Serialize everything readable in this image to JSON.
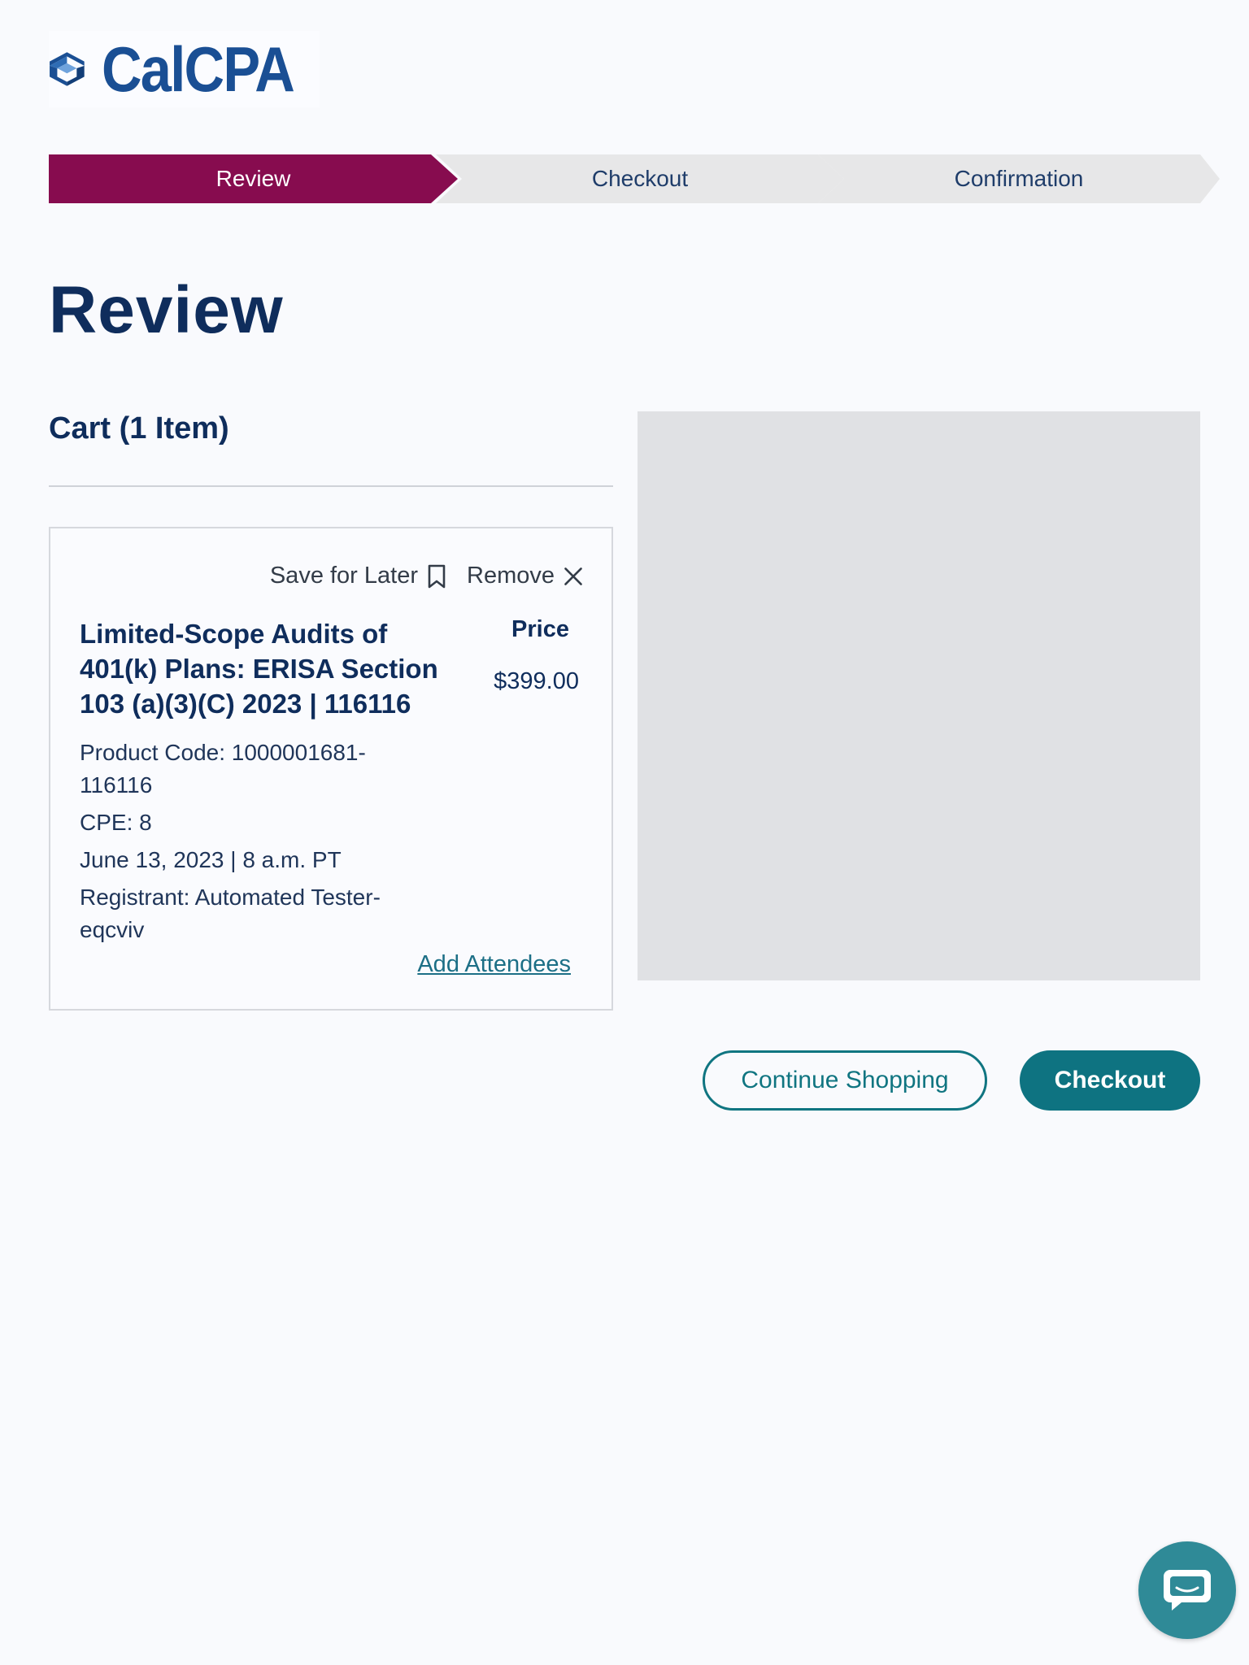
{
  "brand": {
    "name": "CalCPA",
    "icon": "calcpa-cube-logo-icon",
    "color": "#1a4f94"
  },
  "steps": [
    {
      "label": "Review",
      "active": true
    },
    {
      "label": "Checkout",
      "active": false
    },
    {
      "label": "Confirmation",
      "active": false
    }
  ],
  "page_title": "Review",
  "cart": {
    "heading": "Cart (1 Item)",
    "item": {
      "save_label": "Save for Later",
      "save_icon": "bookmark-icon",
      "remove_label": "Remove",
      "remove_icon": "close-icon",
      "title": "Limited-Scope Audits of 401(k) Plans: ERISA Section 103 (a)(3)(C) 2023 | 116116",
      "price_label": "Price",
      "price": "$399.00",
      "product_code": "Product Code: 1000001681-116116",
      "cpe": "CPE: 8",
      "date": "June 13, 2023 | 8 a.m. PT",
      "registrant": "Registrant: Automated Tester-eqcviv",
      "add_attendees": "Add Attendees"
    }
  },
  "buttons": {
    "continue_shopping": "Continue Shopping",
    "checkout": "Checkout"
  },
  "chat": {
    "icon": "chat-bubble-icon"
  },
  "colors": {
    "active_step": "#870c4f",
    "inactive_step": "#e7e7e8",
    "primary_button": "#0e7381",
    "link": "#1c6f86",
    "heading": "#0f2d5c"
  }
}
